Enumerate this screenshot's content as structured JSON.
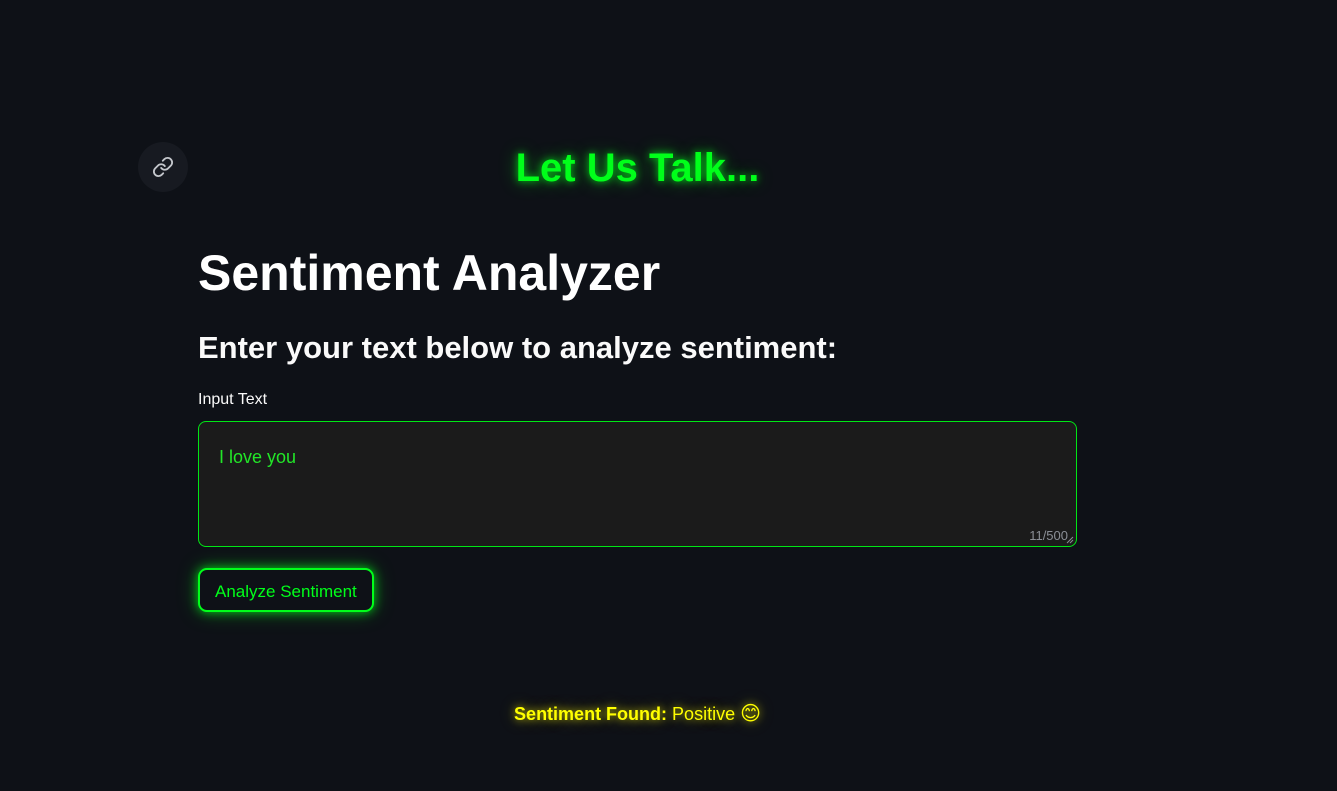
{
  "banner": {
    "text": "Let Us Talk...",
    "color": "#00ff1a"
  },
  "header": {
    "link_icon": "link-icon"
  },
  "main": {
    "title": "Sentiment Analyzer",
    "subtitle": "Enter your text below to analyze sentiment:",
    "input": {
      "label": "Input Text",
      "value": "I love you",
      "counter": "11/500"
    },
    "analyze_button_label": "Analyze Sentiment"
  },
  "result": {
    "label": "Sentiment Found:",
    "value": "Positive",
    "emoji": "😊",
    "color": "#ffff00"
  },
  "colors": {
    "background": "#0e1117",
    "accent": "#00ff1a",
    "textarea_bg": "#1b1b1b"
  }
}
